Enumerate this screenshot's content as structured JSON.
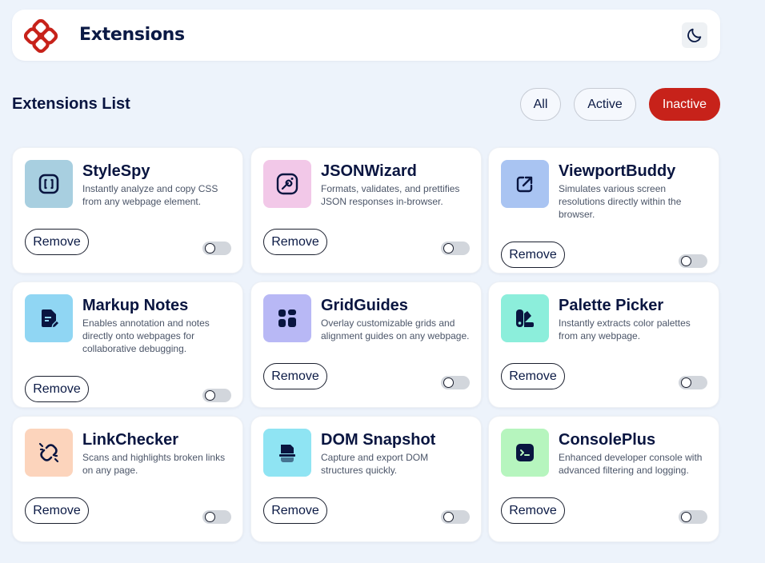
{
  "header": {
    "brand": "Extensions",
    "logo_icon": "extensions-logo-icon",
    "theme_icon": "moon-icon",
    "brand_color": "#c7221a"
  },
  "list": {
    "title": "Extensions List",
    "filters": [
      "All",
      "Active",
      "Inactive"
    ],
    "selected_filter": "Inactive"
  },
  "extensions": [
    {
      "name": "StyleSpy",
      "description": "Instantly analyze and copy CSS from any webpage element.",
      "remove_label": "Remove",
      "active": false,
      "icon": "style-brackets-icon",
      "icon_bg": "#a8cfe0"
    },
    {
      "name": "JSONWizard",
      "description": "Formats, validates, and prettifies JSON responses in-browser.",
      "remove_label": "Remove",
      "active": false,
      "icon": "wand-icon",
      "icon_bg": "#f2c8e8"
    },
    {
      "name": "ViewportBuddy",
      "description": "Simulates various screen resolutions directly within the browser.",
      "remove_label": "Remove",
      "active": false,
      "icon": "resize-arrow-icon",
      "icon_bg": "#a9c4f2"
    },
    {
      "name": "Markup Notes",
      "description": "Enables annotation and notes directly onto webpages for collaborative debugging.",
      "remove_label": "Remove",
      "active": false,
      "icon": "note-pen-icon",
      "icon_bg": "#90d6f3"
    },
    {
      "name": "GridGuides",
      "description": "Overlay customizable grids and alignment guides on any webpage.",
      "remove_label": "Remove",
      "active": false,
      "icon": "grid-icon",
      "icon_bg": "#b8b8f5"
    },
    {
      "name": "Palette Picker",
      "description": "Instantly extracts color palettes from any webpage.",
      "remove_label": "Remove",
      "active": false,
      "icon": "palette-icon",
      "icon_bg": "#8ceedb"
    },
    {
      "name": "LinkChecker",
      "description": "Scans and highlights broken links on any page.",
      "remove_label": "Remove",
      "active": false,
      "icon": "broken-link-icon",
      "icon_bg": "#fcd4bc"
    },
    {
      "name": "DOM Snapshot",
      "description": "Capture and export DOM structures quickly.",
      "remove_label": "Remove",
      "active": false,
      "icon": "snapshot-icon",
      "icon_bg": "#8fe4f3"
    },
    {
      "name": "ConsolePlus",
      "description": "Enhanced developer console with advanced filtering and logging.",
      "remove_label": "Remove",
      "active": false,
      "icon": "terminal-icon",
      "icon_bg": "#b6f5be"
    }
  ]
}
